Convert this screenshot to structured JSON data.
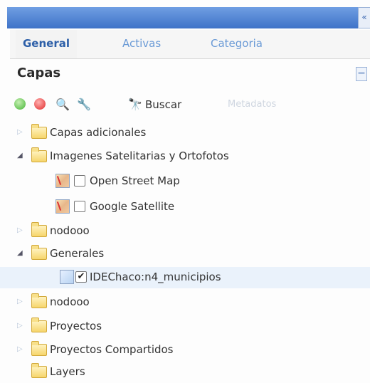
{
  "header": {
    "collapse_glyph": "«"
  },
  "tabs": [
    {
      "label": "General",
      "active": true
    },
    {
      "label": "Activas",
      "active": false
    },
    {
      "label": "Categoria",
      "active": false
    }
  ],
  "panel": {
    "title": "Capas",
    "collapse_glyph": "−"
  },
  "toolbar": {
    "add_icon": "add-icon",
    "remove_icon": "remove-icon",
    "zoom_icon": "zoom-icon",
    "wrench_icon": "wrench-icon",
    "binoculars_glyph": "🔭",
    "buscar_label": "Buscar",
    "metadatos_label": "Metadatos"
  },
  "tree": [
    {
      "label": "Capas adicionales"
    },
    {
      "label": "Imagenes Satelitarias y Ortofotos"
    },
    {
      "label": "Open Street Map",
      "checked": false
    },
    {
      "label": "Google Satellite",
      "checked": false
    },
    {
      "label": "nodooo"
    },
    {
      "label": "Generales"
    },
    {
      "label": "IDEChaco:n4_municipios",
      "checked": true
    },
    {
      "label": "nodooo"
    },
    {
      "label": "Proyectos"
    },
    {
      "label": "Proyectos Compartidos"
    },
    {
      "label": "Layers"
    }
  ],
  "glyphs": {
    "arrow_collapsed": "▷",
    "arrow_expanded": "◢",
    "check": "✔"
  },
  "colors": {
    "header_blue": "#3f73c8",
    "tab_active": "#2d5fa8",
    "tab_inactive": "#6a9ad6",
    "selected_row": "#eaf2fb"
  }
}
